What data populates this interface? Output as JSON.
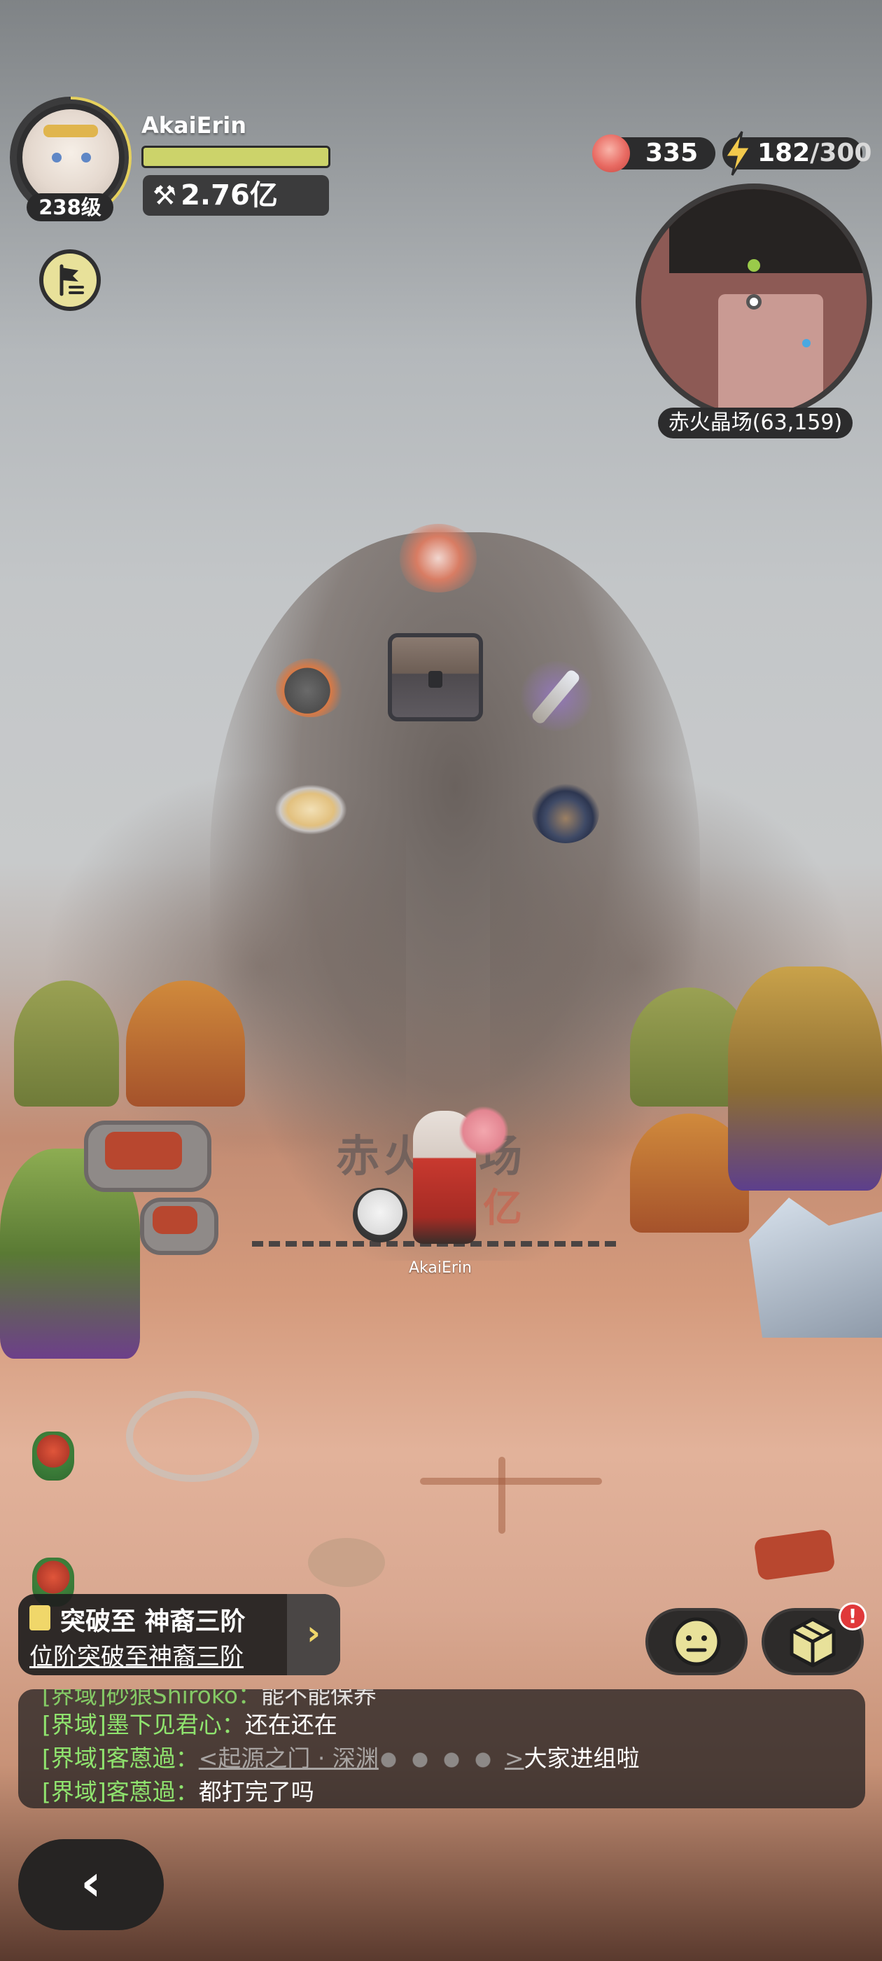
{
  "player": {
    "name": "AkaiErin",
    "level": "238级",
    "hp_fraction": 1.0,
    "power": "2.76亿",
    "power_icon": "crossed-tools-icon"
  },
  "resources": {
    "peach": {
      "icon": "peach-icon",
      "value": "335"
    },
    "energy": {
      "icon": "lightning-icon",
      "current": "182",
      "separator": "/",
      "max": "300"
    }
  },
  "map": {
    "location_label": "赤火晶场(63,159)"
  },
  "scene": {
    "zone_title": "赤火晶场",
    "zone_subtitle": "亿",
    "character_label": "AkaiErin"
  },
  "quest": {
    "title": "突破至 神裔三阶",
    "detail": "位阶突破至神裔三阶",
    "arrow": "›"
  },
  "chat": {
    "lines": [
      {
        "channel": "[界域]",
        "speaker": "砂狼Shiroko：",
        "text": "能不能保养"
      },
      {
        "channel": "[界域]",
        "speaker": "墨下见君心：",
        "text": "还在还在"
      },
      {
        "channel": "[界域]",
        "speaker": "客蒽過：",
        "link": "<起源之门 · 深渊",
        "link_end": ">",
        "text": "大家进组啦"
      },
      {
        "channel": "[界域]",
        "speaker": "客蒽過：",
        "text": "都打完了吗"
      }
    ]
  },
  "buttons": {
    "back": "‹",
    "emote_icon": "neutral-face-icon",
    "box_icon": "cube-box-icon",
    "flag_icon": "flag-list-icon",
    "alert_badge": "!"
  },
  "colors": {
    "hp": "#ccd36a",
    "chat_channel": "#8fe36e",
    "energy_bolt": "#f2c94c",
    "alert": "#e0383a"
  }
}
